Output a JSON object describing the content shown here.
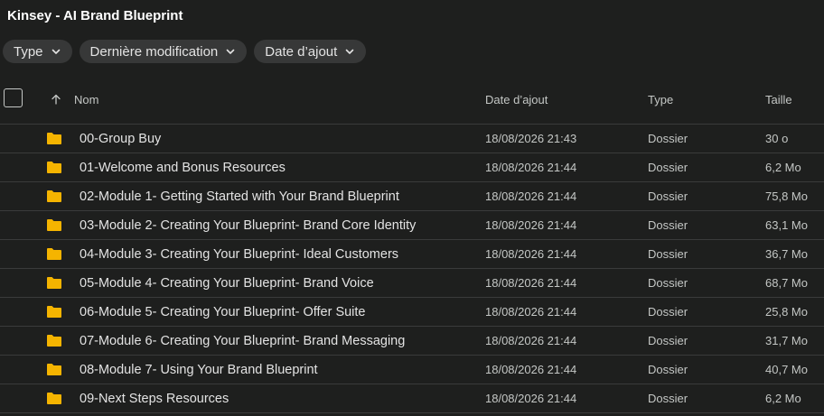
{
  "header": {
    "title": "Kinsey - AI Brand Blueprint"
  },
  "filters": [
    {
      "label": "Type",
      "icon": "chevron-down-icon"
    },
    {
      "label": "Dernière modification",
      "icon": "chevron-down-icon"
    },
    {
      "label": "Date d’ajout",
      "icon": "chevron-down-icon"
    }
  ],
  "table": {
    "sort_icon": "arrow-up-icon",
    "columns": {
      "name": "Nom",
      "date": "Date d’ajout",
      "type": "Type",
      "size": "Taille"
    },
    "rows": [
      {
        "name": "00-Group Buy",
        "date": "18/08/2026 21:43",
        "type": "Dossier",
        "size": "30 o"
      },
      {
        "name": "01-Welcome and Bonus Resources",
        "date": "18/08/2026 21:44",
        "type": "Dossier",
        "size": "6,2 Mo"
      },
      {
        "name": "02-Module 1- Getting Started with Your Brand Blueprint",
        "date": "18/08/2026 21:44",
        "type": "Dossier",
        "size": "75,8 Mo"
      },
      {
        "name": "03-Module 2- Creating Your Blueprint- Brand Core Identity",
        "date": "18/08/2026 21:44",
        "type": "Dossier",
        "size": "63,1 Mo"
      },
      {
        "name": "04-Module 3- Creating Your Blueprint- Ideal Customers",
        "date": "18/08/2026 21:44",
        "type": "Dossier",
        "size": "36,7 Mo"
      },
      {
        "name": "05-Module 4- Creating Your Blueprint- Brand Voice",
        "date": "18/08/2026 21:44",
        "type": "Dossier",
        "size": "68,7 Mo"
      },
      {
        "name": "06-Module 5- Creating Your Blueprint- Offer Suite",
        "date": "18/08/2026 21:44",
        "type": "Dossier",
        "size": "25,8 Mo"
      },
      {
        "name": "07-Module 6- Creating Your Blueprint- Brand Messaging",
        "date": "18/08/2026 21:44",
        "type": "Dossier",
        "size": "31,7 Mo"
      },
      {
        "name": "08-Module 7- Using Your Brand Blueprint",
        "date": "18/08/2026 21:44",
        "type": "Dossier",
        "size": "40,7 Mo"
      },
      {
        "name": "09-Next Steps Resources",
        "date": "18/08/2026 21:44",
        "type": "Dossier",
        "size": "6,2 Mo"
      }
    ]
  },
  "colors": {
    "background": "#1e1f1e",
    "chip": "#373838",
    "folder": "#f5b400",
    "divider": "#3a3b3b"
  }
}
